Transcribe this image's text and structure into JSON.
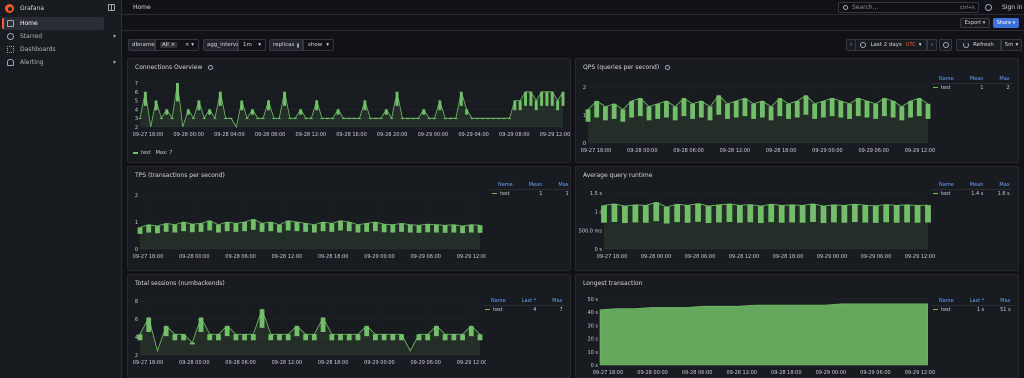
{
  "app": {
    "brand": "Grafana",
    "breadcrumb": "Home"
  },
  "sidebar": {
    "items": [
      {
        "label": "Home",
        "icon": "home-icon",
        "active": true
      },
      {
        "label": "Starred",
        "icon": "star-icon",
        "chevron": true
      },
      {
        "label": "Dashboards",
        "icon": "dashboards-icon"
      },
      {
        "label": "Alerting",
        "icon": "bell-icon",
        "chevron": true
      }
    ]
  },
  "search": {
    "placeholder": "Search...",
    "shortcut": "ctrl+k"
  },
  "topbar": {
    "signin": "Sign in"
  },
  "toolbar": {
    "export_label": "Export",
    "share_label": "Share"
  },
  "variables": {
    "dbname": {
      "label": "dbname",
      "value": "All"
    },
    "agg_interval": {
      "label": "agg_interval",
      "value": "1m"
    },
    "replicas": {
      "label": "replicas",
      "value": "show"
    }
  },
  "timepicker": {
    "range": "Last 2 days",
    "tz": "UTC",
    "refresh_label": "Refresh",
    "refresh_interval": "5m"
  },
  "colors": {
    "series": "#73bf69",
    "accent": "#f55f3e",
    "primary": "#3d71d9",
    "legend_header": "#6e9fff"
  },
  "panels": [
    {
      "title": "Connections Overview",
      "legend": {
        "series": "test",
        "text": "Max: 7"
      },
      "chart_data": {
        "type": "line",
        "yticks": [
          "7",
          "6",
          "5",
          "4",
          "3",
          "2"
        ],
        "xticks": [
          "09-27 18:00",
          "09-28 00:00",
          "09-28 04:00",
          "09-28 08:00",
          "09-28 12:00",
          "09-28 16:00",
          "09-28 20:00",
          "09-29 00:00",
          "09-29 04:00",
          "09-29 08:00",
          "09-29 12:00"
        ],
        "ylim": [
          2,
          7
        ],
        "series": [
          {
            "name": "test",
            "values": [
              3,
              6,
              2,
              5,
              3,
              4,
              3,
              7,
              2,
              4,
              3,
              5,
              3,
              4,
              3,
              6,
              3,
              3,
              2,
              5,
              3,
              4,
              3,
              3,
              5,
              3,
              3,
              6,
              3,
              3,
              4,
              3,
              3,
              5,
              3,
              3,
              3,
              4,
              3,
              3,
              3,
              3,
              5,
              3,
              3,
              3,
              4,
              3,
              6,
              3,
              3,
              3,
              3,
              4,
              3,
              3,
              5,
              3,
              3,
              3,
              6,
              4,
              3,
              3,
              3,
              3,
              3,
              3,
              3,
              3,
              5,
              5,
              6,
              6,
              5,
              6,
              6,
              6,
              5,
              6
            ]
          }
        ]
      }
    },
    {
      "title": "QPS (queries per second)",
      "legend_table": {
        "columns": [
          "Name",
          "Mean",
          "Max"
        ],
        "rows": [
          [
            "test",
            "1",
            "2"
          ]
        ]
      },
      "chart_data": {
        "type": "line",
        "yticks": [
          "2",
          "1",
          "0"
        ],
        "xticks": [
          "09-27 18:00",
          "09-28 00:00",
          "09-28 06:00",
          "09-28 12:00",
          "09-28 18:00",
          "09-29 00:00",
          "09-29 06:00",
          "09-29 12:00"
        ],
        "ylim": [
          0,
          2
        ],
        "series": [
          {
            "name": "test",
            "values": [
              1.2,
              1.5,
              1.3,
              1.4,
              1.2,
              1.5,
              1.6,
              1.3,
              1.4,
              1.5,
              1.3,
              1.6,
              1.4,
              1.5,
              1.3,
              1.7,
              1.4,
              1.5,
              1.6,
              1.4,
              1.5,
              1.3,
              1.6,
              1.4,
              1.5,
              1.7,
              1.4,
              1.5,
              1.6,
              1.5,
              1.4,
              1.6,
              1.5,
              1.4,
              1.6,
              1.5,
              1.3,
              1.5,
              1.6,
              1.4
            ]
          }
        ]
      }
    },
    {
      "title": "TPS (transactions per second)",
      "legend_table": {
        "columns": [
          "Name",
          "Mean",
          "Max"
        ],
        "rows": [
          [
            "test",
            "1",
            "1"
          ]
        ]
      },
      "chart_data": {
        "type": "line",
        "yticks": [
          "2",
          "1",
          "0"
        ],
        "xticks": [
          "09-27 18:00",
          "09-28 00:00",
          "09-28 06:00",
          "09-28 12:00",
          "09-28 18:00",
          "09-29 00:00",
          "09-29 06:00",
          "09-29 12:00"
        ],
        "ylim": [
          0,
          2
        ],
        "series": [
          {
            "name": "test",
            "values": [
              0.8,
              0.9,
              0.85,
              0.95,
              0.9,
              1.0,
              0.92,
              0.95,
              1.05,
              0.9,
              1.0,
              0.95,
              1.0,
              1.1,
              0.95,
              1.0,
              0.9,
              1.05,
              1.0,
              0.95,
              0.9,
              1.0,
              0.95,
              1.05,
              1.0,
              0.9,
              0.95,
              1.0,
              0.92,
              0.9,
              0.95,
              0.9,
              0.88,
              0.92,
              0.9,
              0.88,
              0.9,
              0.85,
              0.9,
              0.88
            ]
          }
        ]
      }
    },
    {
      "title": "Average query runtime",
      "legend_table": {
        "columns": [
          "Name",
          "Mean",
          "Max"
        ],
        "rows": [
          [
            "test",
            "1.4 s",
            "1.6 s"
          ]
        ]
      },
      "chart_data": {
        "type": "line",
        "yticks": [
          "1.5 s",
          "1 s",
          "500.0 ms",
          "0 s"
        ],
        "xticks": [
          "09-27 18:00",
          "09-28 00:00",
          "09-28 06:00",
          "09-28 12:00",
          "09-28 18:00",
          "09-29 00:00",
          "09-29 06:00",
          "09-29 12:00"
        ],
        "ylim": [
          0,
          1.8
        ],
        "series": [
          {
            "name": "test",
            "values": [
              1.4,
              1.45,
              1.38,
              1.42,
              1.4,
              1.5,
              1.35,
              1.44,
              1.4,
              1.46,
              1.38,
              1.42,
              1.45,
              1.4,
              1.43,
              1.38,
              1.44,
              1.4,
              1.42,
              1.4,
              1.45,
              1.38,
              1.42,
              1.4,
              1.44,
              1.41,
              1.39,
              1.43,
              1.4,
              1.42,
              1.4,
              1.41
            ]
          }
        ]
      }
    },
    {
      "title": "Total sessions (numbackends)",
      "legend_table": {
        "columns": [
          "Name",
          "Last *",
          "Max"
        ],
        "rows": [
          [
            "test",
            "4",
            "7"
          ]
        ]
      },
      "chart_data": {
        "type": "line",
        "yticks": [
          "8",
          "6",
          "4",
          "2"
        ],
        "xticks": [
          "09-27 18:00",
          "09-28 00:00",
          "09-28 06:00",
          "09-28 12:00",
          "09-28 18:00",
          "09-29 00:00",
          "09-29 06:00",
          "09-29 12:00"
        ],
        "ylim": [
          1.5,
          8
        ],
        "series": [
          {
            "name": "test",
            "values": [
              4,
              6,
              2,
              5,
              4,
              4,
              3,
              6,
              4,
              4,
              5,
              4,
              4,
              4,
              7,
              4,
              4,
              4,
              5,
              4,
              4,
              6,
              4,
              4,
              4,
              4,
              5,
              4,
              4,
              4,
              4,
              2,
              4,
              4,
              5,
              4,
              4,
              4,
              5,
              4
            ]
          }
        ]
      }
    },
    {
      "title": "Longest transaction",
      "legend_table": {
        "columns": [
          "Name",
          "Last *",
          "Max"
        ],
        "rows": [
          [
            "test",
            "1 s",
            "51 s"
          ]
        ]
      },
      "chart_data": {
        "type": "area",
        "yticks": [
          "50 s",
          "40 s",
          "30 s",
          "20 s",
          "10 s",
          "0 s"
        ],
        "xticks": [
          "09-27 18:00",
          "09-28 00:00",
          "09-28 06:00",
          "09-28 12:00",
          "09-28 18:00",
          "09-29 00:00",
          "09-29 06:00",
          "09-29 12:00"
        ],
        "ylim": [
          0,
          55
        ],
        "series": [
          {
            "name": "test",
            "values": [
              46,
              47,
              47,
              48,
              48,
              48,
              49,
              49,
              49,
              50,
              50,
              50,
              50,
              50,
              51,
              51,
              51,
              51,
              51,
              0
            ]
          }
        ]
      }
    }
  ]
}
